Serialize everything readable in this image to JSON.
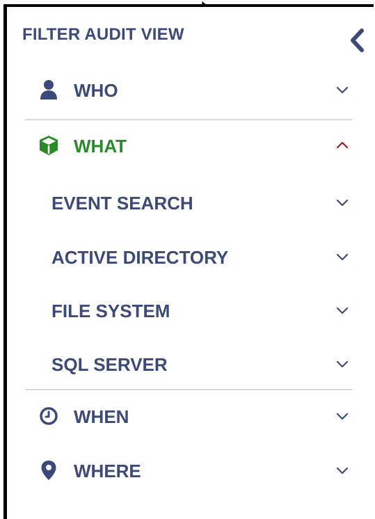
{
  "panel": {
    "title": "FILTER AUDIT VIEW",
    "collapse_icon": "chevron-left-icon"
  },
  "sections": [
    {
      "key": "who",
      "label": "WHO",
      "icon": "user-icon",
      "expanded": false
    },
    {
      "key": "what",
      "label": "WHAT",
      "icon": "cube-icon",
      "expanded": true,
      "children": [
        {
          "label": "EVENT SEARCH"
        },
        {
          "label": "ACTIVE DIRECTORY"
        },
        {
          "label": "FILE SYSTEM"
        },
        {
          "label": "SQL SERVER"
        }
      ]
    },
    {
      "key": "when",
      "label": "WHEN",
      "icon": "clock-icon",
      "expanded": false
    },
    {
      "key": "where",
      "label": "WHERE",
      "icon": "location-pin-icon",
      "expanded": false
    }
  ],
  "colors": {
    "text": "#3c4a7a",
    "active": "#2a8a2a",
    "expanded_chevron": "#9b1c1c",
    "divider": "#d9dbe3"
  }
}
